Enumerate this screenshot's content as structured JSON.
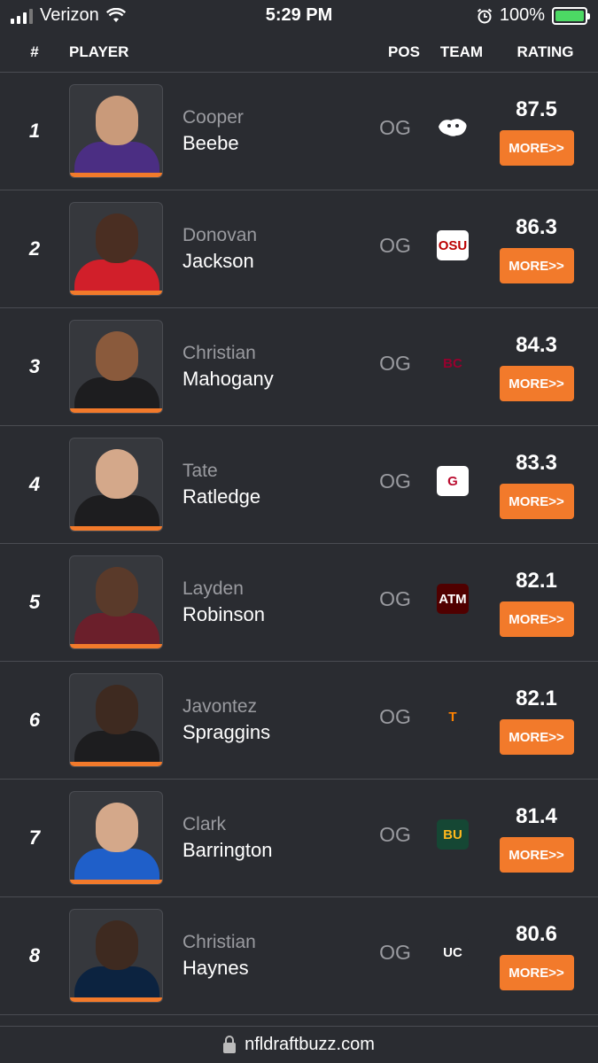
{
  "status_bar": {
    "carrier": "Verizon",
    "time": "5:29 PM",
    "battery_percent": "100%",
    "battery_level": 1.0
  },
  "table": {
    "headers": {
      "num": "#",
      "player": "PLAYER",
      "pos": "POS",
      "team": "TEAM",
      "rating": "RATING"
    },
    "rows": [
      {
        "rank": "1",
        "first": "Cooper",
        "last": "Beebe",
        "pos": "OG",
        "rating": "87.5",
        "more": "MORE>>",
        "team_icon": "wildcat-logo-icon",
        "jersey": "#4b2e83",
        "skin": "#c99a7a",
        "logo_text": "",
        "logo_bg": "#2a2c31",
        "logo_fg": "#ffffff"
      },
      {
        "rank": "2",
        "first": "Donovan",
        "last": "Jackson",
        "pos": "OG",
        "rating": "86.3",
        "more": "MORE>>",
        "team_icon": "ohio-state-logo-icon",
        "jersey": "#d11f2a",
        "skin": "#4a2e22",
        "logo_text": "OSU",
        "logo_bg": "#ffffff",
        "logo_fg": "#bb0000"
      },
      {
        "rank": "3",
        "first": "Christian",
        "last": "Mahogany",
        "pos": "OG",
        "rating": "84.3",
        "more": "MORE>>",
        "team_icon": "boston-college-logo-icon",
        "jersey": "#1d1d1f",
        "skin": "#8a5a3c",
        "logo_text": "BC",
        "logo_bg": "#2a2c31",
        "logo_fg": "#98002e"
      },
      {
        "rank": "4",
        "first": "Tate",
        "last": "Ratledge",
        "pos": "OG",
        "rating": "83.3",
        "more": "MORE>>",
        "team_icon": "georgia-logo-icon",
        "jersey": "#1d1d1f",
        "skin": "#d4a88a",
        "logo_text": "G",
        "logo_bg": "#ffffff",
        "logo_fg": "#ba0c2f"
      },
      {
        "rank": "5",
        "first": "Layden",
        "last": "Robinson",
        "pos": "OG",
        "rating": "82.1",
        "more": "MORE>>",
        "team_icon": "texas-am-logo-icon",
        "jersey": "#6b1f2b",
        "skin": "#5a3a2a",
        "logo_text": "ATM",
        "logo_bg": "#500000",
        "logo_fg": "#ffffff"
      },
      {
        "rank": "6",
        "first": "Javontez",
        "last": "Spraggins",
        "pos": "OG",
        "rating": "82.1",
        "more": "MORE>>",
        "team_icon": "tennessee-logo-icon",
        "jersey": "#1d1d1f",
        "skin": "#3e2a20",
        "logo_text": "T",
        "logo_bg": "#2a2c31",
        "logo_fg": "#ff8200"
      },
      {
        "rank": "7",
        "first": "Clark",
        "last": "Barrington",
        "pos": "OG",
        "rating": "81.4",
        "more": "MORE>>",
        "team_icon": "baylor-logo-icon",
        "jersey": "#1f5fc9",
        "skin": "#d4a88a",
        "logo_text": "BU",
        "logo_bg": "#154734",
        "logo_fg": "#ffb81c"
      },
      {
        "rank": "8",
        "first": "Christian",
        "last": "Haynes",
        "pos": "OG",
        "rating": "80.6",
        "more": "MORE>>",
        "team_icon": "uconn-logo-icon",
        "jersey": "#0c2340",
        "skin": "#3e2a20",
        "logo_text": "UC",
        "logo_bg": "#2a2c31",
        "logo_fg": "#ffffff"
      }
    ]
  },
  "url_bar": {
    "domain": "nfldraftbuzz.com"
  },
  "colors": {
    "accent": "#f27a2b",
    "background": "#2a2c31",
    "divider": "#4a4c52"
  }
}
